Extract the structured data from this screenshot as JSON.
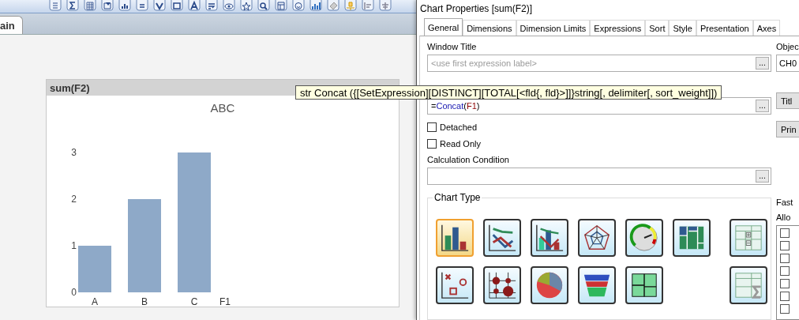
{
  "sheet_tabs": [
    {
      "label": "ain",
      "selected": true
    }
  ],
  "chart_object": {
    "caption": "sum(F2)",
    "chart_data": {
      "type": "bar",
      "title": "ABC",
      "xlabel": "F1",
      "categories": [
        "A",
        "B",
        "C"
      ],
      "values": [
        1,
        2,
        3
      ],
      "ylim": [
        0,
        3
      ],
      "yticks": [
        0,
        1,
        2,
        3
      ]
    }
  },
  "tooltip": {
    "text": "str Concat ({[SetExpression][DISTINCT][TOTAL[<fld{, fld}>]]}string[, delimiter[, sort_weight]])"
  },
  "dialog": {
    "title": "Chart Properties [sum(F2)]",
    "tabs": [
      {
        "label": "General",
        "selected": true
      },
      {
        "label": "Dimensions",
        "selected": false
      },
      {
        "label": "Dimension Limits",
        "selected": false
      },
      {
        "label": "Expressions",
        "selected": false
      },
      {
        "label": "Sort",
        "selected": false
      },
      {
        "label": "Style",
        "selected": false
      },
      {
        "label": "Presentation",
        "selected": false
      },
      {
        "label": "Axes",
        "selected": false
      }
    ],
    "window_title": {
      "label": "Window Title",
      "placeholder": "<use first expression label>",
      "button": "..."
    },
    "expression": {
      "tokens": [
        {
          "text": "=",
          "kind": "operator"
        },
        {
          "text": "Concat",
          "kind": "function"
        },
        {
          "text": "(",
          "kind": "operator"
        },
        {
          "text": "F1",
          "kind": "field"
        },
        {
          "text": ")",
          "kind": "operator"
        }
      ],
      "button": "..."
    },
    "options": [
      {
        "label": "Detached",
        "checked": false
      },
      {
        "label": "Read Only",
        "checked": false
      }
    ],
    "calculation_condition": {
      "label": "Calculation Condition",
      "button": "..."
    },
    "chart_type": {
      "label": "Chart Type",
      "rows": [
        [
          {
            "kind": "bar",
            "selected": true
          },
          {
            "kind": "line",
            "selected": false
          },
          {
            "kind": "combo",
            "selected": false
          },
          {
            "kind": "radar",
            "selected": false
          },
          {
            "kind": "gauge",
            "selected": false
          },
          {
            "kind": "block",
            "selected": false
          },
          {
            "kind": "pivot",
            "selected": false
          }
        ],
        [
          {
            "kind": "scatter",
            "selected": false
          },
          {
            "kind": "grid",
            "selected": false
          },
          {
            "kind": "pie",
            "selected": false
          },
          {
            "kind": "funnel",
            "selected": false
          },
          {
            "kind": "mekko",
            "selected": false
          },
          {
            "kind": "straight",
            "selected": false
          }
        ]
      ]
    },
    "object_id": {
      "label": "Objec",
      "value": "CH0"
    },
    "side_buttons": [
      "Titl",
      "Prin"
    ],
    "fast_type_change": {
      "label": "Fast",
      "allow_label": "Allo",
      "options": [
        {
          "checked": false
        },
        {
          "checked": false
        },
        {
          "checked": false
        },
        {
          "checked": false
        },
        {
          "checked": false
        },
        {
          "checked": false
        },
        {
          "checked": false
        }
      ]
    }
  }
}
